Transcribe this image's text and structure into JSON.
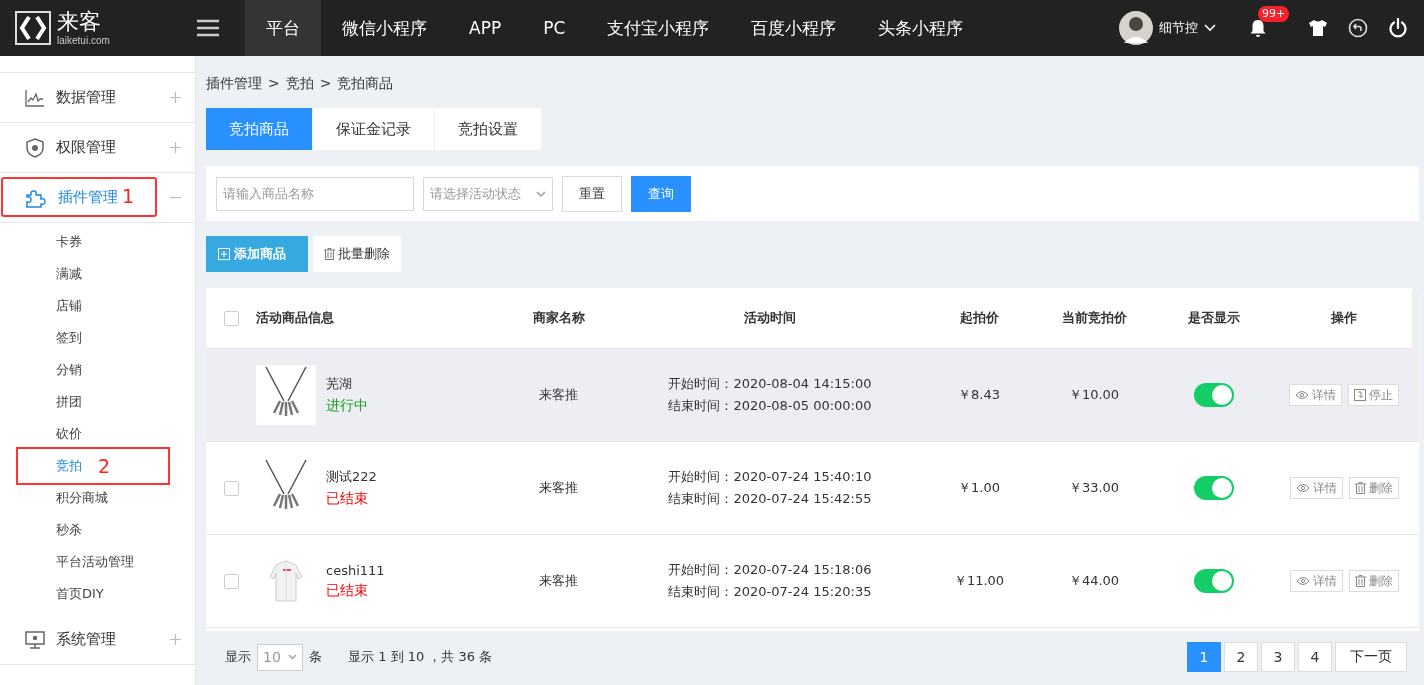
{
  "header": {
    "logo_text": "来客",
    "logo_domain": "laiketui.com",
    "nav": [
      {
        "label": "平台",
        "selected": true
      },
      {
        "label": "微信小程序",
        "selected": false
      },
      {
        "label": "APP",
        "selected": false
      },
      {
        "label": "PC",
        "selected": false
      },
      {
        "label": "支付宝小程序",
        "selected": false
      },
      {
        "label": "百度小程序",
        "selected": false
      },
      {
        "label": "头条小程序",
        "selected": false
      }
    ],
    "user": "细节控",
    "badge": "99+"
  },
  "sidebar": {
    "items": [
      {
        "label": "数据管理",
        "expanded": false
      },
      {
        "label": "权限管理",
        "expanded": false
      },
      {
        "label": "插件管理",
        "expanded": true,
        "annotation": "1",
        "children": [
          {
            "label": "卡券",
            "selected": false
          },
          {
            "label": "满减",
            "selected": false
          },
          {
            "label": "店铺",
            "selected": false
          },
          {
            "label": "签到",
            "selected": false
          },
          {
            "label": "分销",
            "selected": false
          },
          {
            "label": "拼团",
            "selected": false
          },
          {
            "label": "砍价",
            "selected": false
          },
          {
            "label": "竞拍",
            "selected": true,
            "annotation": "2"
          },
          {
            "label": "积分商城",
            "selected": false
          },
          {
            "label": "秒杀",
            "selected": false
          },
          {
            "label": "平台活动管理",
            "selected": false
          },
          {
            "label": "首页DIY",
            "selected": false
          }
        ]
      },
      {
        "label": "系统管理",
        "expanded": false
      }
    ]
  },
  "breadcrumb": [
    "插件管理",
    "竞拍",
    "竞拍商品"
  ],
  "breadcrumb_sep": ">",
  "tabs": [
    {
      "label": "竞拍商品",
      "selected": true
    },
    {
      "label": "保证金记录",
      "selected": false
    },
    {
      "label": "竞拍设置",
      "selected": false
    }
  ],
  "filter": {
    "name_placeholder": "请输入商品名称",
    "status_placeholder": "请选择活动状态",
    "reset": "重置",
    "query": "查询"
  },
  "toolbar": {
    "add": "添加商品",
    "batch_delete": "批量删除"
  },
  "table": {
    "all_checked": false,
    "columns": [
      "活动商品信息",
      "商家名称",
      "活动时间",
      "起拍价",
      "当前竞拍价",
      "是否显示",
      "操作"
    ],
    "rows": [
      {
        "highlighted": true,
        "name": "芜湖",
        "status": "进行中",
        "color": "#1a9d1a",
        "merchant": "来客推",
        "start": "开始时间：2020-08-04 14:15:00",
        "end": "结束时间：2020-08-05 00:00:00",
        "start_price": "￥8.43",
        "current_price": "￥10.00",
        "on": true,
        "actions": [
          {
            "label": "详情",
            "kind": "view"
          },
          {
            "label": "停止",
            "kind": "stop"
          }
        ]
      },
      {
        "highlighted": false,
        "checked": false,
        "name": "测试222",
        "status": "已结束",
        "color": "#ff0000",
        "merchant": "来客推",
        "start": "开始时间：2020-07-24 15:40:10",
        "end": "结束时间：2020-07-24 15:42:55",
        "start_price": "￥1.00",
        "current_price": "￥33.00",
        "on": true,
        "actions": [
          {
            "label": "详情",
            "kind": "view"
          },
          {
            "label": "删除",
            "kind": "delete"
          }
        ]
      },
      {
        "highlighted": false,
        "checked": false,
        "name": "ceshi111",
        "status": "已结束",
        "color": "#ff0000",
        "merchant": "来客推",
        "start": "开始时间：2020-07-24 15:18:06",
        "end": "结束时间：2020-07-24 15:20:35",
        "start_price": "￥11.00",
        "current_price": "￥44.00",
        "on": true,
        "actions": [
          {
            "label": "详情",
            "kind": "view"
          },
          {
            "label": "删除",
            "kind": "delete"
          }
        ]
      }
    ]
  },
  "pagination": {
    "show": "显示",
    "page_size": "10",
    "unit": "条",
    "summary": "显示 1 到 10 ，共 36 条",
    "pages": [
      {
        "label": "1",
        "selected": true
      },
      {
        "label": "2",
        "selected": false
      },
      {
        "label": "3",
        "selected": false
      },
      {
        "label": "4",
        "selected": false
      }
    ],
    "next": "下一页"
  }
}
